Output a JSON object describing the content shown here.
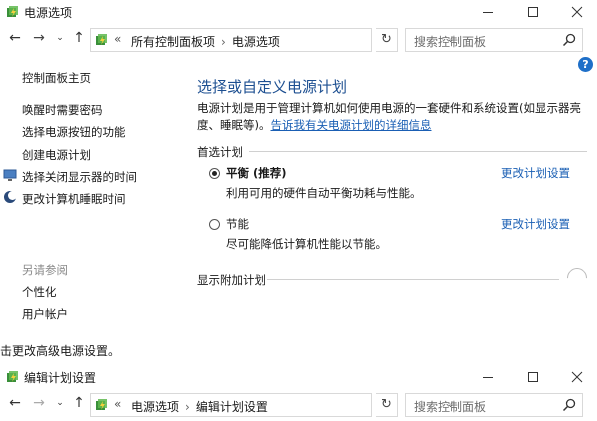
{
  "window1": {
    "title": "电源选项",
    "controls": {
      "minimize": "—",
      "maximize": "☐",
      "close": "✕"
    },
    "nav": {
      "back": "←",
      "forward": "→",
      "recent": "⌄",
      "up": "↑"
    },
    "address": {
      "lead": "«",
      "crumbs": [
        "所有控制面板项",
        "电源选项"
      ],
      "dropdown": "⌄"
    },
    "refresh": "↻",
    "search": {
      "placeholder": "搜索控制面板"
    },
    "help": "?",
    "sidebar": {
      "links": [
        "控制面板主页",
        "唤醒时需要密码",
        "选择电源按钮的功能",
        "创建电源计划",
        "选择关闭显示器的时间",
        "更改计算机睡眠时间"
      ],
      "see_also_heading": "另请参阅",
      "see_also_links": [
        "个性化",
        "用户帐户"
      ]
    },
    "main": {
      "title": "选择或自定义电源计划",
      "description": "电源计划是用于管理计算机如何使用电源的一套硬件和系统设置(如显示器亮度、睡眠等)。",
      "description_link": "告诉我有关电源计划的详细信息",
      "preferred_label": "首选计划",
      "plans": [
        {
          "name": "平衡 (推荐)",
          "desc": "利用可用的硬件自动平衡功耗与性能。",
          "link": "更改计划设置",
          "selected": true
        },
        {
          "name": "节能",
          "desc": "尽可能降低计算机性能以节能。",
          "link": "更改计划设置",
          "selected": false
        }
      ],
      "additional_label": "显示附加计划"
    }
  },
  "caption": "击更改高级电源设置。",
  "window2": {
    "title": "编辑计划设置",
    "controls": {
      "minimize": "—",
      "maximize": "☐",
      "close": "✕"
    },
    "nav": {
      "back": "←",
      "forward": "→",
      "recent": "⌄",
      "up": "↑"
    },
    "address": {
      "lead": "«",
      "crumbs": [
        "电源选项",
        "编辑计划设置"
      ],
      "dropdown": "⌄"
    },
    "refresh": "↻",
    "search": {
      "placeholder": "搜索控制面板"
    }
  },
  "colors": {
    "link": "#1a5fb4",
    "title": "#1d4f91",
    "help": "#1e6fc8"
  }
}
